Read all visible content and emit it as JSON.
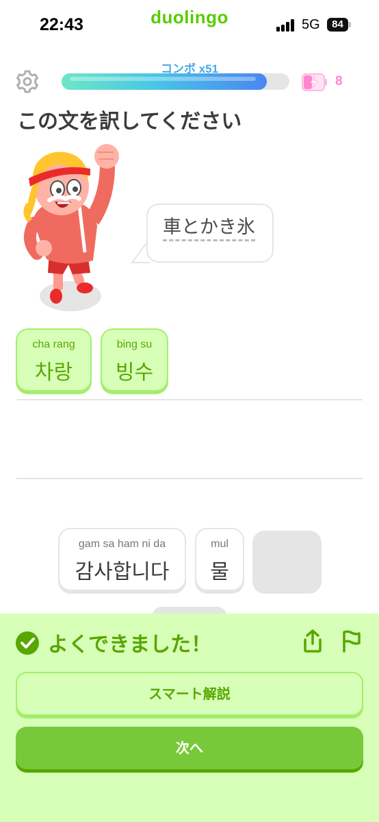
{
  "status_bar": {
    "time": "22:43",
    "app_name": "duolingo",
    "network": "5G",
    "battery": "84"
  },
  "header": {
    "combo_label": "コンボ x51",
    "progress_fraction": 0.9,
    "energy_count": "8",
    "colors": {
      "combo": "#47a9e6",
      "energy": "#ff86d0"
    }
  },
  "challenge": {
    "title": "この文を訳してください",
    "prompt": "車とかき氷"
  },
  "answer": {
    "tiles": [
      {
        "romaji": "cha rang",
        "hangul": "차랑"
      },
      {
        "romaji": "bing su",
        "hangul": "빙수"
      }
    ]
  },
  "word_bank": {
    "tiles": [
      {
        "romaji": "gam sa ham ni da",
        "hangul": "감사합니다"
      },
      {
        "romaji": "mul",
        "hangul": "물"
      }
    ]
  },
  "feedback": {
    "message": "よくできました！",
    "explain_button": "スマート解説",
    "next_button": "次へ",
    "colors": {
      "background": "#d7ffb8",
      "accent": "#58a700",
      "button": "#78c93a"
    }
  }
}
